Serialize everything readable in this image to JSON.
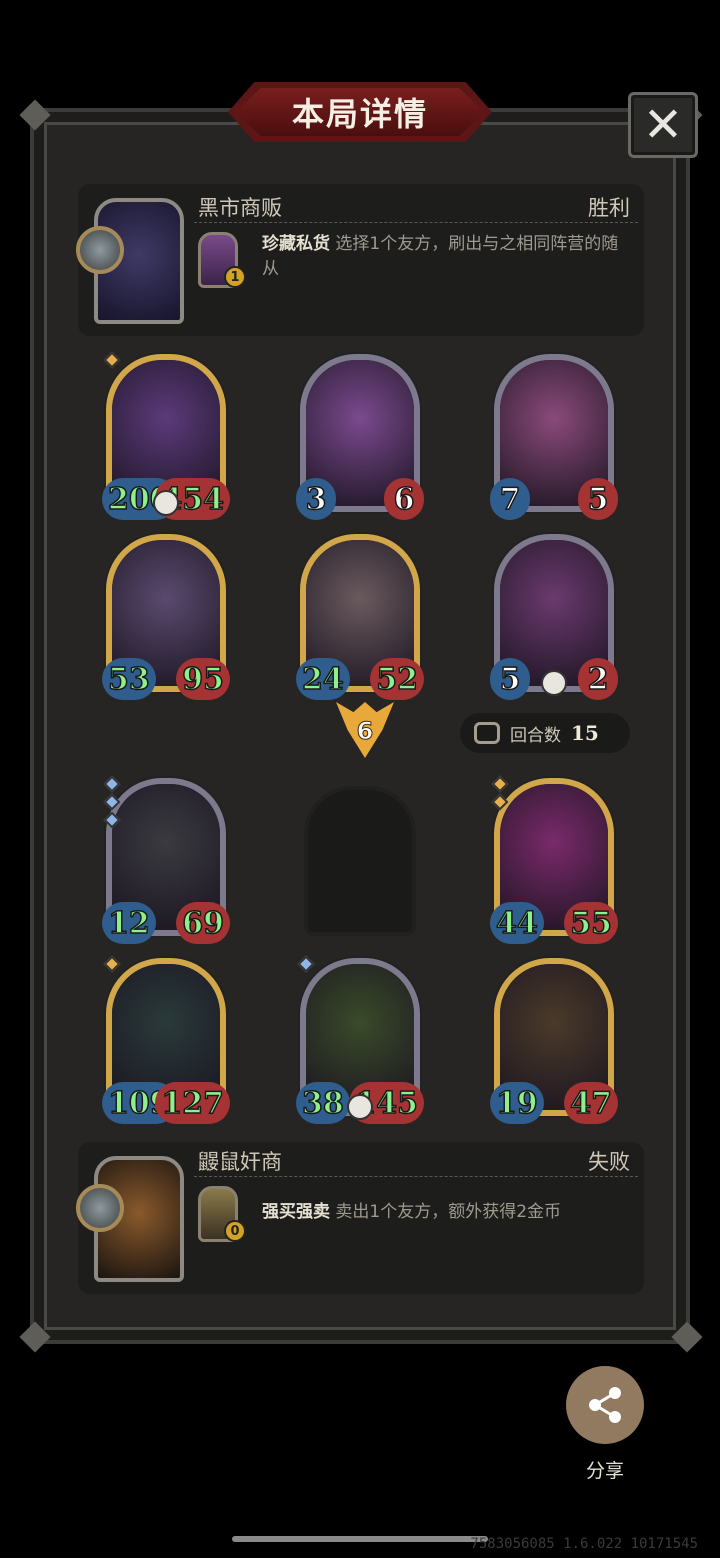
{
  "title": "本局详情",
  "close_label": "✕",
  "opponent_top": {
    "name": "黑市商贩",
    "result": "胜利",
    "skill_name": "珍藏私货",
    "skill_desc": "选择1个友方，刷出与之相同阵营的随从",
    "skill_cost": "1"
  },
  "opponent_cards": [
    {
      "atk": "200",
      "hp": "454",
      "frame": "gold",
      "art": "#5b3a7a",
      "buffed_atk": true,
      "buffed_hp": true,
      "skull": true,
      "gems": [
        "gold"
      ]
    },
    {
      "atk": "3",
      "hp": "6",
      "frame": "silver",
      "art": "#7a4a8e",
      "buffed_atk": false,
      "buffed_hp": false,
      "skull": false,
      "gems": []
    },
    {
      "atk": "7",
      "hp": "5",
      "frame": "silver",
      "art": "#8a4a7a",
      "buffed_atk": false,
      "buffed_hp": false,
      "skull": false,
      "gems": []
    },
    {
      "atk": "53",
      "hp": "95",
      "frame": "gold",
      "art": "#5a4a6e",
      "buffed_atk": true,
      "buffed_hp": true,
      "skull": false,
      "gems": []
    },
    {
      "atk": "24",
      "hp": "52",
      "frame": "gold",
      "art": "#6a5a5e",
      "buffed_atk": true,
      "buffed_hp": true,
      "skull": false,
      "gems": []
    },
    {
      "atk": "5",
      "hp": "2",
      "frame": "silver",
      "art": "#6a3a6e",
      "buffed_atk": false,
      "buffed_hp": false,
      "skull": true,
      "gems": []
    }
  ],
  "tier": "6",
  "round": {
    "label": "回合数",
    "value": "15"
  },
  "player_cards": [
    {
      "atk": "12",
      "hp": "69",
      "frame": "silver",
      "art": "#3a3a40",
      "buffed_atk": true,
      "buffed_hp": true,
      "skull": false,
      "gems": [
        "blue",
        "blue",
        "blue"
      ]
    },
    {
      "atk": "44",
      "hp": "55",
      "frame": "gold",
      "art": "#7a2a6a",
      "buffed_atk": true,
      "buffed_hp": true,
      "skull": false,
      "gems": [
        "gold",
        "gold"
      ]
    },
    {
      "atk": "109",
      "hp": "127",
      "frame": "gold",
      "art": "#2a3a3a",
      "buffed_atk": true,
      "buffed_hp": true,
      "skull": false,
      "gems": [
        "gold"
      ]
    },
    {
      "atk": "38",
      "hp": "145",
      "frame": "silver",
      "art": "#3a4a2a",
      "buffed_atk": true,
      "buffed_hp": true,
      "skull": true,
      "gems": [
        "blue"
      ]
    },
    {
      "atk": "19",
      "hp": "47",
      "frame": "gold",
      "art": "#4a3a2a",
      "buffed_atk": true,
      "buffed_hp": true,
      "skull": false,
      "gems": []
    }
  ],
  "opponent_bottom": {
    "name": "鼹鼠奸商",
    "result": "失败",
    "skill_name": "强买强卖",
    "skill_desc": "卖出1个友方，额外获得2金币",
    "skill_cost": "0"
  },
  "share_label": "分享",
  "watermark": "7583056085 1.6.022 10171545",
  "colors": {
    "accent_gold": "#d1a74a",
    "title_red": "#7a1e1e",
    "buff_green": "#8ef08a",
    "atk_blue": "#2f5e8e",
    "hp_red": "#a63333"
  }
}
